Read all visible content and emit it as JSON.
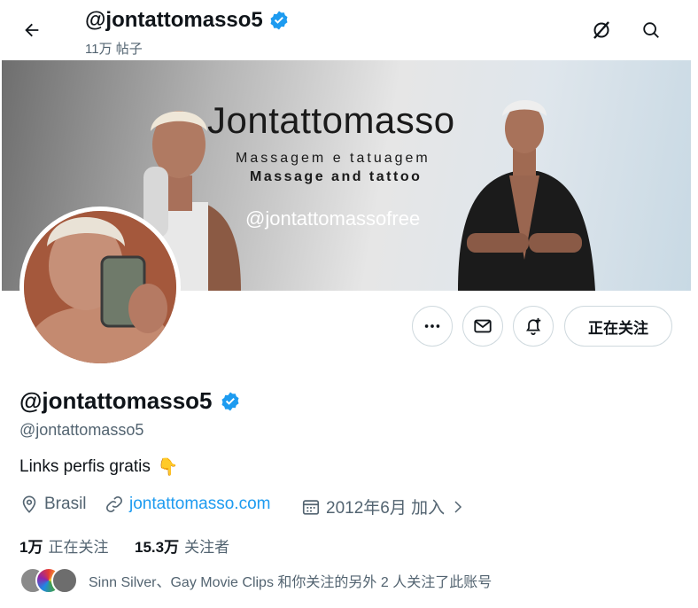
{
  "header": {
    "title": "@jontattomasso5",
    "post_count": "11万 帖子"
  },
  "banner": {
    "title": "Jontattomasso",
    "line1": "Massagem e tatuagem",
    "line2": "Massage and tattoo",
    "handle": "@jontattomassofree"
  },
  "actions": {
    "following_label": "正在关注"
  },
  "profile": {
    "display_name": "@jontattomasso5",
    "handle": "@jontattomasso5",
    "bio": "Links perfis gratis",
    "bio_emoji": "👇",
    "location": "Brasil",
    "website": "jontattomasso.com",
    "joined": "2012年6月 加入"
  },
  "stats": {
    "following_count": "1万",
    "following_label": "正在关注",
    "followers_count": "15.3万",
    "followers_label": "关注者"
  },
  "followed_by": {
    "text": "Sinn Silver、Gay Movie Clips 和你关注的另外 2 人关注了此账号"
  },
  "colors": {
    "accent": "#1d9bf0",
    "verified": "#1d9bf0",
    "secondary_text": "#536471",
    "border": "#cfd9de"
  },
  "icons": [
    "back-arrow-icon",
    "verified-badge-icon",
    "grok-icon",
    "search-icon",
    "more-icon",
    "mail-icon",
    "notification-bell-icon",
    "location-icon",
    "link-icon",
    "calendar-icon",
    "chevron-right-icon"
  ]
}
